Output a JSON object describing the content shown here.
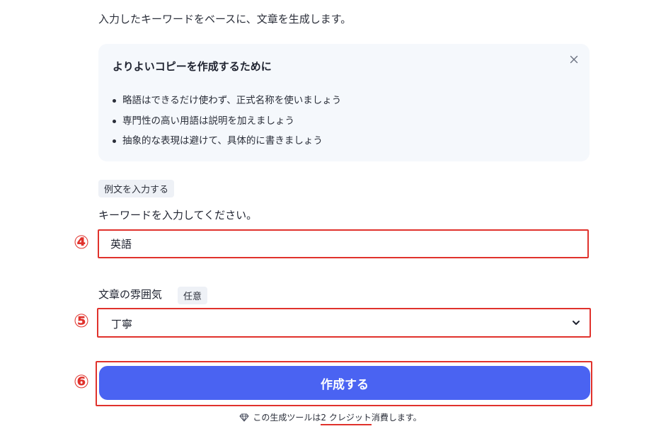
{
  "intro": "入力したキーワードをベースに、文章を生成します。",
  "tips": {
    "title": "よりよいコピーを作成するために",
    "items": [
      "略語はできるだけ使わず、正式名称を使いましょう",
      "専門性の高い用語は説明を加えましょう",
      "抽象的な表現は避けて、具体的に書きましょう"
    ]
  },
  "example_button": "例文を入力する",
  "keyword": {
    "label": "キーワードを入力してください。",
    "value": "英語",
    "marker": "④"
  },
  "tone": {
    "label": "文章の雰囲気",
    "optional": "任意",
    "selected": "丁寧",
    "marker": "⑤"
  },
  "submit": {
    "label": "作成する",
    "marker": "⑥"
  },
  "footer": {
    "prefix": "この生成ツールは",
    "credits": "2 クレジット",
    "suffix": "消費します。"
  },
  "colors": {
    "accent": "#4a63f2",
    "annotation": "#e0322c",
    "tips_bg": "#f5f8fc"
  },
  "icons": {
    "close": "close-icon",
    "dropdown": "chevron-down-icon",
    "gem": "diamond-icon"
  }
}
